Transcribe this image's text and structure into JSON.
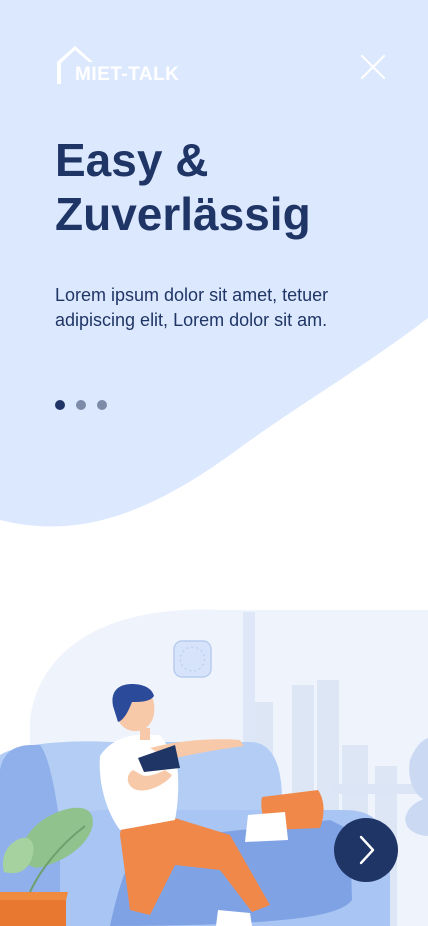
{
  "brand": {
    "logo_text": "MIET-TALK",
    "colors": {
      "primary": "#1f3566",
      "background_shape": "#dce8fd",
      "white": "#ffffff"
    }
  },
  "header": {
    "close_icon": "close-icon"
  },
  "onboarding": {
    "title_line1": "Easy &",
    "title_line2": "Zuverlässig",
    "description": "Lorem ipsum dolor sit amet, tetuer adipiscing elit, Lorem dolor sit am.",
    "page_indicator": {
      "current": 1,
      "total": 3
    }
  },
  "actions": {
    "next_icon": "chevron-right-icon"
  },
  "illustration": {
    "subject": "person-reading-on-sofa"
  }
}
